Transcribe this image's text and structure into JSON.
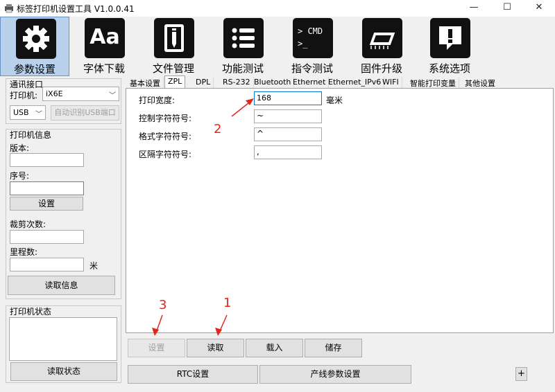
{
  "window": {
    "title": "标签打印机设置工具 V1.0.0.41",
    "minimize": "—",
    "maximize": "☐",
    "close": "✕"
  },
  "toolbar": [
    {
      "label": "参数设置",
      "icon": "gear-icon",
      "active": true
    },
    {
      "label": "字体下载",
      "icon": "font-aa-icon",
      "glyph": "Aa"
    },
    {
      "label": "文件管理",
      "icon": "file-pencil-icon"
    },
    {
      "label": "功能测试",
      "icon": "list-icon"
    },
    {
      "label": "指令测试",
      "icon": "command-prompt-icon",
      "glyph1": "> CMD",
      "glyph2": ">_"
    },
    {
      "label": "固件升级",
      "icon": "chip-icon"
    },
    {
      "label": "系统选项",
      "icon": "message-alert-icon",
      "glyph": "!"
    }
  ],
  "comm": {
    "title": "通讯接口",
    "printer_label": "打印机:",
    "printer_value": "iX6E",
    "port_value": "USB",
    "auto_detect_label": "自动识别USB端口"
  },
  "info": {
    "title": "打印机信息",
    "version_label": "版本:",
    "version_value": "",
    "serial_label": "序号:",
    "serial_value": "",
    "set_button": "设置",
    "cut_label": "裁剪次数:",
    "cut_value": "",
    "mileage_label": "里程数:",
    "mileage_value": "",
    "mileage_unit": "米",
    "read_info_button": "读取信息"
  },
  "status": {
    "title": "打印机状态",
    "read_button": "读取状态"
  },
  "tabs": [
    "基本设置",
    "ZPL",
    "DPL",
    "RS-232",
    "Bluetooth",
    "Ethernet",
    "Ethernet_IPv6",
    "WIFI",
    "智能打印变量",
    "其他设置"
  ],
  "zpl": {
    "width_label": "打印宽度:",
    "width_value": "168",
    "width_unit": "毫米",
    "control_label": "控制字符符号:",
    "control_value": "~",
    "format_label": "格式字符符号:",
    "format_value": "^",
    "delimiter_label": "区隔字符符号:",
    "delimiter_value": ","
  },
  "actions": {
    "set": "设置",
    "read": "读取",
    "load": "载入",
    "save": "储存"
  },
  "bottom": {
    "rtc": "RTC设置",
    "production": "产线参数设置",
    "plus": "+"
  },
  "annotations": {
    "one": "1",
    "two": "2",
    "three": "3"
  },
  "colors": {
    "annotation": "#e3261d",
    "active_tab_bg": "#b9d1ea",
    "focus_border": "#0078d7"
  }
}
